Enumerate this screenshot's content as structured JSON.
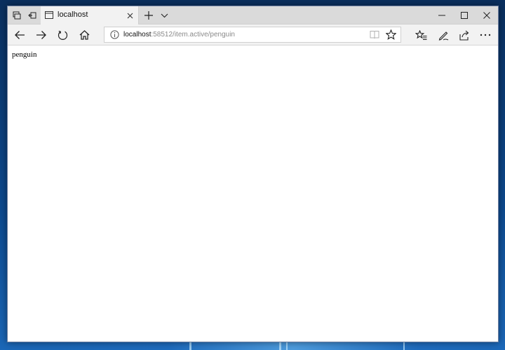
{
  "browser": {
    "tab": {
      "title": "localhost"
    },
    "address": {
      "host": "localhost",
      "port_path": ":58512/item.active/penguin"
    }
  },
  "page": {
    "body_text": "penguin"
  },
  "icons": [
    "tab-preview-icon",
    "tabs-aside-icon",
    "page-icon",
    "close-tab-icon",
    "new-tab-plus-icon",
    "chevron-down-icon",
    "minimize-icon",
    "maximize-icon",
    "window-close-icon",
    "back-arrow-icon",
    "forward-arrow-icon",
    "refresh-icon",
    "home-icon",
    "info-icon",
    "reading-view-icon",
    "star-icon",
    "favorites-list-icon",
    "pen-icon",
    "share-icon",
    "more-dots-icon"
  ],
  "colors": {
    "accent": "#0078d7",
    "chrome": "#f2f2f2",
    "titlebar": "#dadada"
  }
}
